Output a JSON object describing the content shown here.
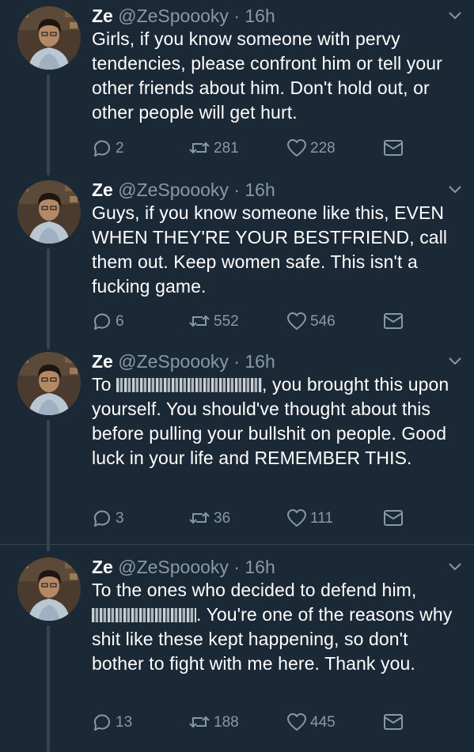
{
  "tweets": [
    {
      "name": "Ze",
      "handle": "@ZeSpoooky",
      "dot": "·",
      "time": "16h",
      "text": "Girls, if you know someone with pervy tendencies, please confront him or tell your other friends about him. Don't hold out, or other people will get hurt.",
      "replies": "2",
      "retweets": "281",
      "likes": "228"
    },
    {
      "name": "Ze",
      "handle": "@ZeSpoooky",
      "dot": "·",
      "time": "16h",
      "text": "Guys, if you know someone like this, EVEN WHEN THEY'RE YOUR BESTFRIEND, call them out. Keep women safe. This isn't a fucking game.",
      "replies": "6",
      "retweets": "552",
      "likes": "546"
    },
    {
      "name": "Ze",
      "handle": "@ZeSpoooky",
      "dot": "·",
      "time": "16h",
      "text_before": "To ",
      "text_after": ", you brought this upon yourself. You should've thought about this before pulling your bullshit on people. Good luck in your life and REMEMBER THIS.",
      "replies": "3",
      "retweets": "36",
      "likes": "111"
    },
    {
      "name": "Ze",
      "handle": "@ZeSpoooky",
      "dot": "·",
      "time": "16h",
      "text_before": "To the ones who decided to defend him, ",
      "text_after": ". You're one of the reasons why shit like these kept happening, so don't bother to fight with me here. Thank you.",
      "replies": "13",
      "retweets": "188",
      "likes": "445"
    }
  ],
  "colors": {
    "background": "#1b2836",
    "text": "#ffffff",
    "muted": "#8899a6",
    "divider": "#38444d"
  },
  "icons": [
    "avatar",
    "chevron-down-icon",
    "reply-icon",
    "retweet-icon",
    "like-icon",
    "dm-icon"
  ]
}
